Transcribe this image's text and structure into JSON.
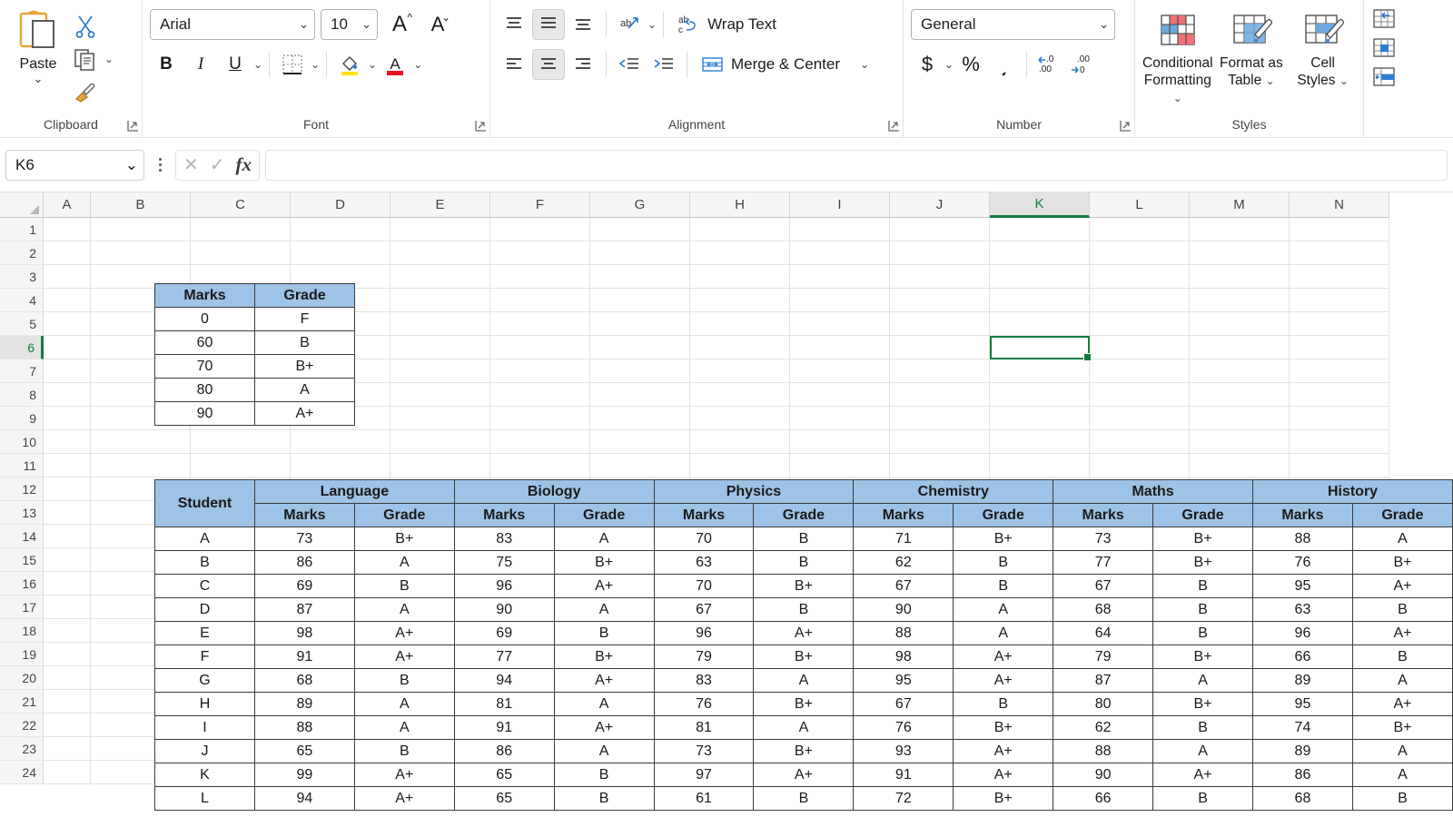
{
  "ribbon": {
    "groups": [
      {
        "name": "Clipboard",
        "label": "Clipboard"
      },
      {
        "name": "Font",
        "label": "Font"
      },
      {
        "name": "Alignment",
        "label": "Alignment"
      },
      {
        "name": "Number",
        "label": "Number"
      },
      {
        "name": "Styles",
        "label": "Styles"
      }
    ],
    "clipboard": {
      "paste_label": "Paste",
      "group_label": "Clipboard"
    },
    "font": {
      "group_label": "Font",
      "font_name": "Arial",
      "font_size": "10",
      "bold": "B",
      "italic": "I",
      "underline": "U"
    },
    "alignment": {
      "group_label": "Alignment",
      "wrap_text": "Wrap Text",
      "merge_center": "Merge & Center"
    },
    "number": {
      "group_label": "Number",
      "format": "General",
      "currency": "$",
      "percent": "%",
      "comma": "͵"
    },
    "styles": {
      "group_label": "Styles",
      "conditional_formatting": "Conditional\nFormatting",
      "conditional_formatting_l1": "Conditional",
      "conditional_formatting_l2": "Formatting",
      "format_as_table_l1": "Format as",
      "format_as_table_l2": "Table",
      "cell_styles_l1": "Cell",
      "cell_styles_l2": "Styles"
    }
  },
  "formula_bar": {
    "name_box": "K6",
    "formula_value": "",
    "formula_placeholder": ""
  },
  "grid": {
    "columns": [
      "A",
      "B",
      "C",
      "D",
      "E",
      "F",
      "G",
      "H",
      "I",
      "J",
      "K",
      "L",
      "M",
      "N"
    ],
    "active_column": "K",
    "active_row": "6",
    "rows": [
      "1",
      "2",
      "3",
      "4",
      "5",
      "6",
      "7",
      "8",
      "9",
      "10",
      "11",
      "12",
      "13",
      "14",
      "15",
      "16",
      "17",
      "18",
      "19",
      "20",
      "21",
      "22",
      "23",
      "24"
    ]
  },
  "lookup_table": {
    "headers": [
      "Marks",
      "Grade"
    ],
    "rows": [
      [
        "0",
        "F"
      ],
      [
        "60",
        "B"
      ],
      [
        "70",
        "B+"
      ],
      [
        "80",
        "A"
      ],
      [
        "90",
        "A+"
      ]
    ]
  },
  "marks_table": {
    "student_header": "Student",
    "subjects": [
      "Language",
      "Biology",
      "Physics",
      "Chemistry",
      "Maths",
      "History"
    ],
    "sub_headers": [
      "Marks",
      "Grade"
    ],
    "rows": [
      {
        "student": "A",
        "cells": [
          "73",
          "B+",
          "83",
          "A",
          "70",
          "B",
          "71",
          "B+",
          "73",
          "B+",
          "88",
          "A"
        ]
      },
      {
        "student": "B",
        "cells": [
          "86",
          "A",
          "75",
          "B+",
          "63",
          "B",
          "62",
          "B",
          "77",
          "B+",
          "76",
          "B+"
        ]
      },
      {
        "student": "C",
        "cells": [
          "69",
          "B",
          "96",
          "A+",
          "70",
          "B+",
          "67",
          "B",
          "67",
          "B",
          "95",
          "A+"
        ]
      },
      {
        "student": "D",
        "cells": [
          "87",
          "A",
          "90",
          "A",
          "67",
          "B",
          "90",
          "A",
          "68",
          "B",
          "63",
          "B"
        ]
      },
      {
        "student": "E",
        "cells": [
          "98",
          "A+",
          "69",
          "B",
          "96",
          "A+",
          "88",
          "A",
          "64",
          "B",
          "96",
          "A+"
        ]
      },
      {
        "student": "F",
        "cells": [
          "91",
          "A+",
          "77",
          "B+",
          "79",
          "B+",
          "98",
          "A+",
          "79",
          "B+",
          "66",
          "B"
        ]
      },
      {
        "student": "G",
        "cells": [
          "68",
          "B",
          "94",
          "A+",
          "83",
          "A",
          "95",
          "A+",
          "87",
          "A",
          "89",
          "A"
        ]
      },
      {
        "student": "H",
        "cells": [
          "89",
          "A",
          "81",
          "A",
          "76",
          "B+",
          "67",
          "B",
          "80",
          "B+",
          "95",
          "A+"
        ]
      },
      {
        "student": "I",
        "cells": [
          "88",
          "A",
          "91",
          "A+",
          "81",
          "A",
          "76",
          "B+",
          "62",
          "B",
          "74",
          "B+"
        ]
      },
      {
        "student": "J",
        "cells": [
          "65",
          "B",
          "86",
          "A",
          "73",
          "B+",
          "93",
          "A+",
          "88",
          "A",
          "89",
          "A"
        ]
      },
      {
        "student": "K",
        "cells": [
          "99",
          "A+",
          "65",
          "B",
          "97",
          "A+",
          "91",
          "A+",
          "90",
          "A+",
          "86",
          "A"
        ]
      },
      {
        "student": "L",
        "cells": [
          "94",
          "A+",
          "65",
          "B",
          "61",
          "B",
          "72",
          "B+",
          "66",
          "B",
          "68",
          "B"
        ]
      }
    ]
  },
  "colors": {
    "header_fill": "#9dc3e6",
    "accent_green": "#107c41",
    "grid_line": "#e3e3e3",
    "table_border": "#3b3b3b"
  }
}
